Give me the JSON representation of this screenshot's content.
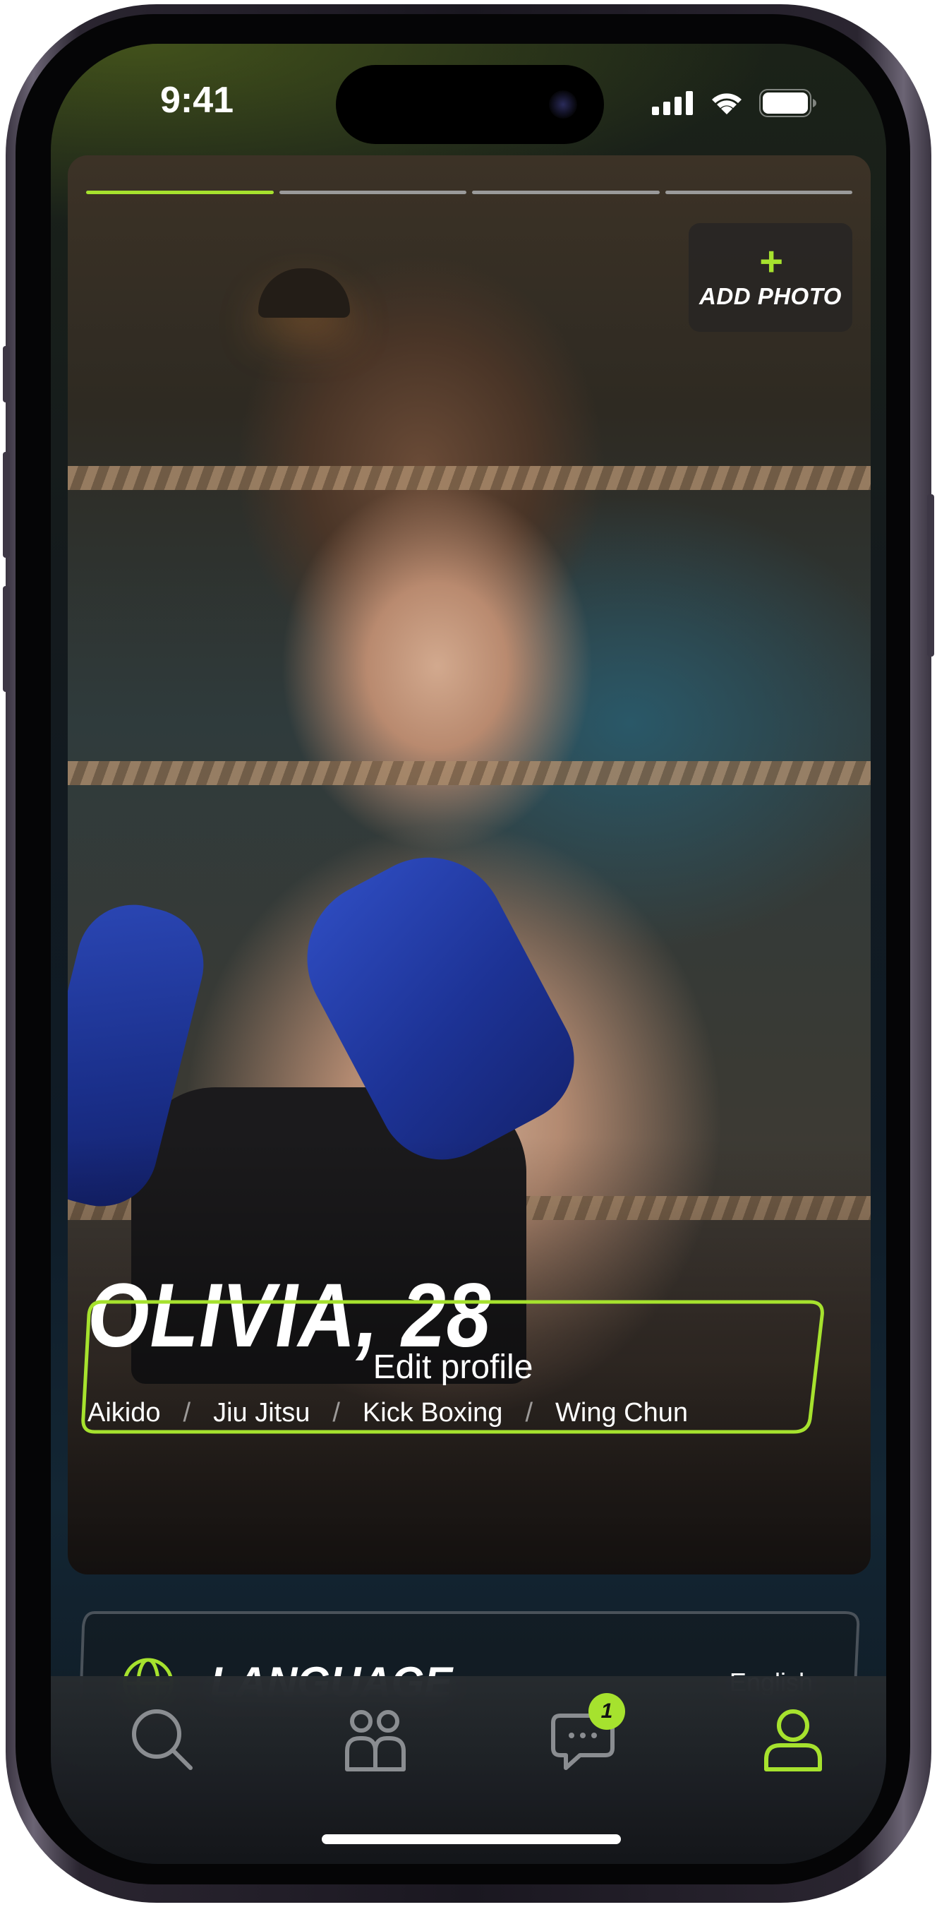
{
  "status_bar": {
    "time": "9:41",
    "icons": [
      "cellular-signal-icon",
      "wifi-icon",
      "battery-icon"
    ]
  },
  "photo": {
    "progress_segments": 4,
    "active_segment": 1,
    "add_photo_label": "ADD PHOTO",
    "add_photo_icon": "plus-icon"
  },
  "profile": {
    "name_age": "OLIVIA, 28",
    "sports": [
      "Aikido",
      "Jiu Jitsu",
      "Kick Boxing",
      "Wing Chun"
    ],
    "sport_separator": "/",
    "edit_label": "Edit profile"
  },
  "language": {
    "title": "LANGUAGE",
    "value": "English",
    "icon": "globe-icon"
  },
  "tab_bar": {
    "items": [
      {
        "id": "search",
        "icon": "search-icon",
        "active": false
      },
      {
        "id": "community",
        "icon": "people-icon",
        "active": false
      },
      {
        "id": "messages",
        "icon": "chat-icon",
        "active": false,
        "badge": "1"
      },
      {
        "id": "profile",
        "icon": "user-icon",
        "active": true
      }
    ]
  },
  "colors": {
    "accent": "#a6e22e",
    "inactive_icon": "#8a8d91",
    "text": "#ffffff"
  }
}
